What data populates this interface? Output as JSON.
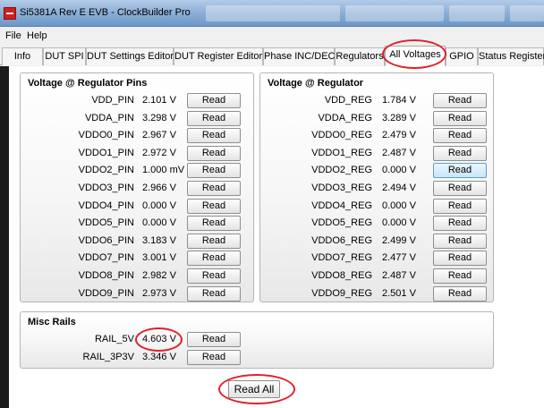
{
  "window": {
    "title": "Si5381A Rev E EVB - ClockBuilder Pro",
    "background_tabs": [
      "",
      "",
      "",
      ""
    ]
  },
  "menu": [
    "File",
    "Help"
  ],
  "tabs": [
    "Info",
    "DUT SPI",
    "DUT Settings Editor",
    "DUT Register Editor",
    "Phase INC/DEC",
    "Regulators",
    "All Voltages",
    "GPIO",
    "Status Registers"
  ],
  "active_tab": "All Voltages",
  "read_label": "Read",
  "read_all_label": "Read All",
  "pins_panel": {
    "title": "Voltage @ Regulator Pins",
    "rows": [
      {
        "label": "VDD_PIN",
        "value": "2.101 V"
      },
      {
        "label": "VDDA_PIN",
        "value": "3.298 V"
      },
      {
        "label": "VDDO0_PIN",
        "value": "2.967 V"
      },
      {
        "label": "VDDO1_PIN",
        "value": "2.972 V"
      },
      {
        "label": "VDDO2_PIN",
        "value": "1.000 mV"
      },
      {
        "label": "VDDO3_PIN",
        "value": "2.966 V"
      },
      {
        "label": "VDDO4_PIN",
        "value": "0.000 V"
      },
      {
        "label": "VDDO5_PIN",
        "value": "0.000 V"
      },
      {
        "label": "VDDO6_PIN",
        "value": "3.183 V"
      },
      {
        "label": "VDDO7_PIN",
        "value": "3.001 V"
      },
      {
        "label": "VDDO8_PIN",
        "value": "2.982 V"
      },
      {
        "label": "VDDO9_PIN",
        "value": "2.973 V"
      }
    ]
  },
  "reg_panel": {
    "title": "Voltage @ Regulator",
    "rows": [
      {
        "label": "VDD_REG",
        "value": "1.784 V"
      },
      {
        "label": "VDDA_REG",
        "value": "3.289 V"
      },
      {
        "label": "VDDO0_REG",
        "value": "2.479 V"
      },
      {
        "label": "VDDO1_REG",
        "value": "2.487 V"
      },
      {
        "label": "VDDO2_REG",
        "value": "0.000 V"
      },
      {
        "label": "VDDO3_REG",
        "value": "2.494 V"
      },
      {
        "label": "VDDO4_REG",
        "value": "0.000 V"
      },
      {
        "label": "VDDO5_REG",
        "value": "0.000 V"
      },
      {
        "label": "VDDO6_REG",
        "value": "2.499 V"
      },
      {
        "label": "VDDO7_REG",
        "value": "2.477 V"
      },
      {
        "label": "VDDO8_REG",
        "value": "2.487 V"
      },
      {
        "label": "VDDO9_REG",
        "value": "2.501 V"
      }
    ]
  },
  "misc_panel": {
    "title": "Misc Rails",
    "rows": [
      {
        "label": "RAIL_5V",
        "value": "4.603 V"
      },
      {
        "label": "RAIL_3P3V",
        "value": "3.346 V"
      }
    ]
  },
  "annotation_color": "#e0202a",
  "hovered_read_button": "VDDO2_REG"
}
